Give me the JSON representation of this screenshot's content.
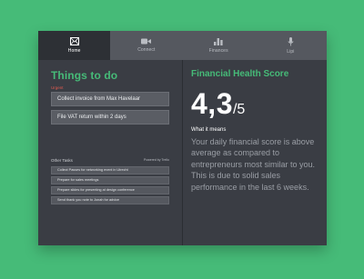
{
  "nav": {
    "items": [
      {
        "label": "Home",
        "icon": "envelope-icon",
        "active": true
      },
      {
        "label": "Connect",
        "icon": "video-camera-icon",
        "active": false
      },
      {
        "label": "Finances",
        "icon": "bar-chart-icon",
        "active": false
      },
      {
        "label": "Lipi",
        "icon": "microphone-icon",
        "active": false
      }
    ]
  },
  "todo": {
    "title": "Things to do",
    "urgent_label": "Urgent",
    "urgent_tasks": [
      "Collect invoice from Max Havelaar",
      "File VAT return within 2 days"
    ],
    "other_label": "Other Tasks",
    "powered_by": "Powered by Trello",
    "other_tasks": [
      "Collect Passes for networking event in Utrecht",
      "Prepare for sales meetings",
      "Prepare slides for presenting at design conference",
      "Send thank you note to Jonah for advice"
    ]
  },
  "health": {
    "title": "Financial Health Score",
    "score": "4,3",
    "out_of": "/5",
    "what_label": "What it means",
    "explanation": "Your daily financial score is above average as compared to entrepreneurs most similar to you. This is due to solid sales performance in the last 6 weeks."
  },
  "colors": {
    "background": "#46bb78",
    "accent": "#46bb78",
    "urgent": "#e05a4f",
    "panel": "#3a3d44"
  }
}
